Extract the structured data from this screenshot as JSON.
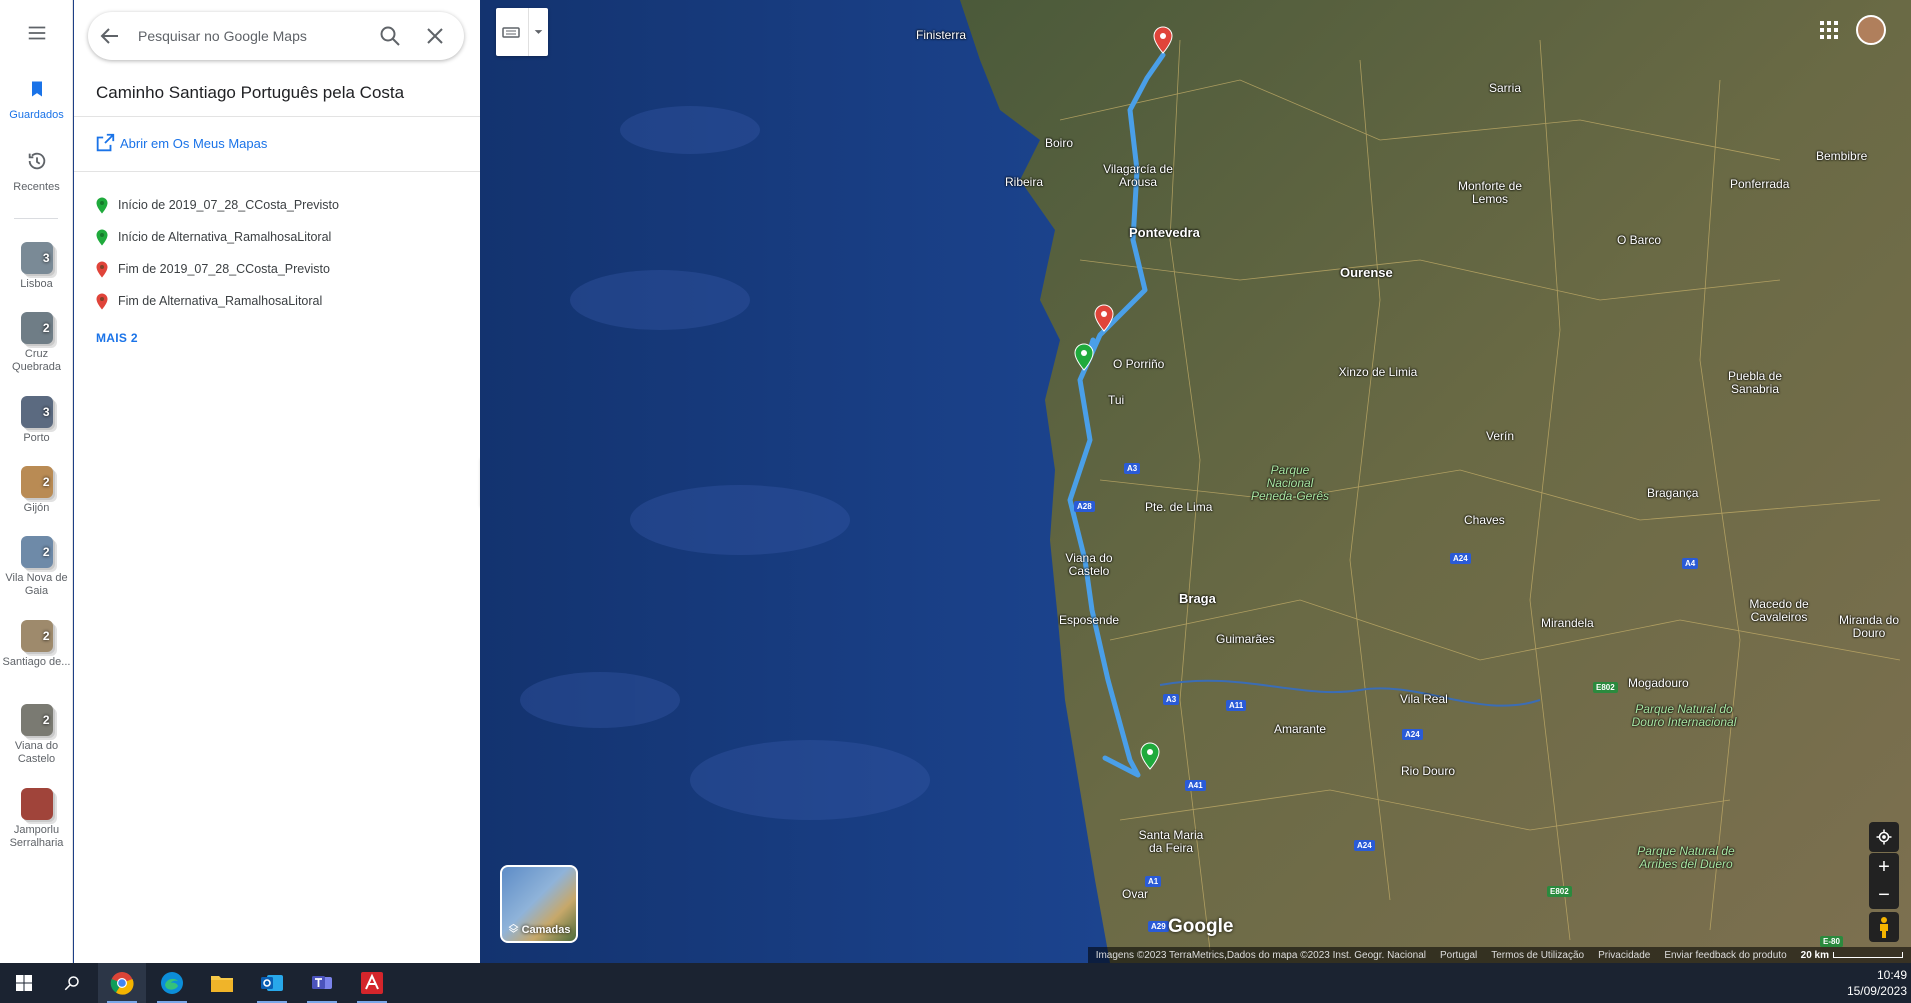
{
  "search": {
    "placeholder": "Pesquisar no Google Maps"
  },
  "panel": {
    "title": "Caminho Santiago Português pela Costa",
    "open_mymaps": "Abrir em Os Meus Mapas",
    "items": [
      {
        "label": "Início de 2019_07_28_CCosta_Previsto",
        "pin": "green"
      },
      {
        "label": "Início de Alternativa_RamalhosaLitoral",
        "pin": "green"
      },
      {
        "label": "Fim de 2019_07_28_CCosta_Previsto",
        "pin": "red"
      },
      {
        "label": "Fim de Alternativa_RamalhosaLitoral",
        "pin": "red"
      }
    ],
    "more": "MAIS 2"
  },
  "rail": {
    "saved": "Guardados",
    "recent": "Recentes",
    "lists": [
      {
        "label": "Lisboa",
        "count": "3",
        "color": "#7a8a96"
      },
      {
        "label": "Cruz Quebrada",
        "count": "2",
        "color": "#6f7d86"
      },
      {
        "label": "Porto",
        "count": "3",
        "color": "#5b6a80"
      },
      {
        "label": "Gijón",
        "count": "2",
        "color": "#b98b54"
      },
      {
        "label": "Vila Nova de Gaia",
        "count": "2",
        "color": "#6e8aa8"
      },
      {
        "label": "Santiago de...",
        "count": "2",
        "color": "#9e8a6c"
      },
      {
        "label": "Viana do Castelo",
        "count": "2",
        "color": "#7a7a72"
      },
      {
        "label": "Jamporlu Serralharia",
        "count": "",
        "color": "#a0443a"
      }
    ]
  },
  "map": {
    "places": [
      {
        "name": "Finisterra",
        "cls": ""
      },
      {
        "name": "Sarria",
        "cls": ""
      },
      {
        "name": "Bembibre",
        "cls": ""
      },
      {
        "name": "Boiro",
        "cls": ""
      },
      {
        "name": "Vilagarcía de Arousa",
        "cls": ""
      },
      {
        "name": "Ribeira",
        "cls": ""
      },
      {
        "name": "Monforte de Lemos",
        "cls": ""
      },
      {
        "name": "Ponferrada",
        "cls": ""
      },
      {
        "name": "Pontevedra",
        "cls": "big"
      },
      {
        "name": "O Barco",
        "cls": ""
      },
      {
        "name": "Ourense",
        "cls": "big"
      },
      {
        "name": "O Porriño",
        "cls": ""
      },
      {
        "name": "Tui",
        "cls": ""
      },
      {
        "name": "Xinzo de Limia",
        "cls": ""
      },
      {
        "name": "Puebla de Sanabria",
        "cls": ""
      },
      {
        "name": "Verín",
        "cls": ""
      },
      {
        "name": "Parque Nacional Peneda-Gerês",
        "cls": "park"
      },
      {
        "name": "Pte. de Lima",
        "cls": ""
      },
      {
        "name": "Bragança",
        "cls": ""
      },
      {
        "name": "Chaves",
        "cls": ""
      },
      {
        "name": "Viana do Castelo",
        "cls": ""
      },
      {
        "name": "Braga",
        "cls": "big"
      },
      {
        "name": "Macedo de Cavaleiros",
        "cls": ""
      },
      {
        "name": "Esposende",
        "cls": ""
      },
      {
        "name": "Mirandela",
        "cls": ""
      },
      {
        "name": "Miranda do Douro",
        "cls": ""
      },
      {
        "name": "Guimarães",
        "cls": ""
      },
      {
        "name": "Mogadouro",
        "cls": ""
      },
      {
        "name": "Amarante",
        "cls": ""
      },
      {
        "name": "Vila Real",
        "cls": ""
      },
      {
        "name": "Parque Natural do Douro Internacional",
        "cls": "park"
      },
      {
        "name": "Rio Douro",
        "cls": ""
      },
      {
        "name": "Santa Maria da Feira",
        "cls": ""
      },
      {
        "name": "Parque Natural de Arribes del Duero",
        "cls": "park"
      },
      {
        "name": "Ovar",
        "cls": ""
      }
    ],
    "shields": [
      {
        "name": "A3",
        "cls": ""
      },
      {
        "name": "A28",
        "cls": ""
      },
      {
        "name": "A24",
        "cls": ""
      },
      {
        "name": "A4",
        "cls": ""
      },
      {
        "name": "E802",
        "cls": "green"
      },
      {
        "name": "A3",
        "cls": ""
      },
      {
        "name": "A11",
        "cls": ""
      },
      {
        "name": "A24",
        "cls": ""
      },
      {
        "name": "A41",
        "cls": ""
      },
      {
        "name": "A24",
        "cls": ""
      },
      {
        "name": "E802",
        "cls": "green"
      },
      {
        "name": "A1",
        "cls": ""
      },
      {
        "name": "A29",
        "cls": ""
      },
      {
        "name": "E-80",
        "cls": "green"
      }
    ],
    "layers_label": "Camadas",
    "logo": "Google",
    "footer": {
      "imagery": "Imagens ©2023 TerraMetrics,Dados do mapa ©2023 Inst. Geogr. Nacional",
      "country": "Portugal",
      "terms": "Termos de Utilização",
      "privacy": "Privacidade",
      "feedback": "Enviar feedback do produto",
      "scale": "20 km"
    }
  },
  "taskbar": {
    "time": "10:49",
    "date": "15/09/2023"
  },
  "colors": {
    "accent": "#1a73e8",
    "route": "#4a9fe8",
    "pin_green": "#1faa3c",
    "pin_red": "#e0443a"
  }
}
